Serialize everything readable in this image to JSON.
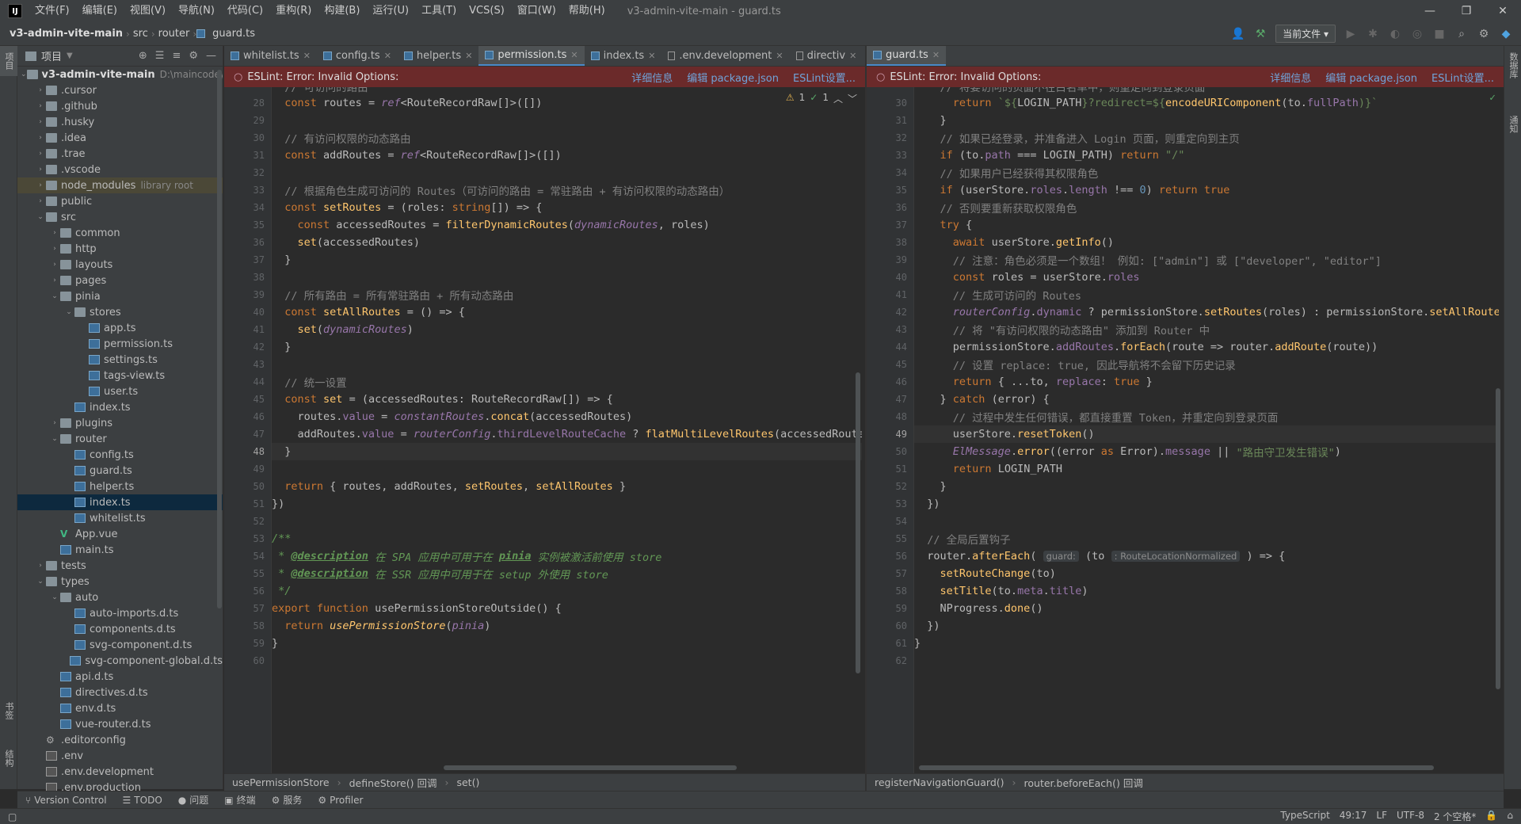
{
  "window": {
    "title": "v3-admin-vite-main - guard.ts",
    "logo": "IJ",
    "menu": [
      "文件(F)",
      "编辑(E)",
      "视图(V)",
      "导航(N)",
      "代码(C)",
      "重构(R)",
      "构建(B)",
      "运行(U)",
      "工具(T)",
      "VCS(S)",
      "窗口(W)",
      "帮助(H)"
    ],
    "controls": [
      "—",
      "❐",
      "✕"
    ]
  },
  "breadcrumb": {
    "project": "v3-admin-vite-main",
    "path": [
      "src",
      "router",
      "guard.ts"
    ]
  },
  "toolbar": {
    "run_config": "当前文件",
    "run_config_arrow": "▾"
  },
  "left_strip": {
    "top_label": "项目",
    "bottom_label_1": "书签",
    "bottom_label_2": "结构"
  },
  "right_strip": {
    "label_1": "数据库",
    "label_2": "通知"
  },
  "project_panel": {
    "title": "项目",
    "root": "v3-admin-vite-main",
    "root_path": "D:\\maincode\\",
    "tree": [
      {
        "depth": 1,
        "arrow": "›",
        "type": "folder",
        "name": ".cursor"
      },
      {
        "depth": 1,
        "arrow": "›",
        "type": "folder",
        "name": ".github"
      },
      {
        "depth": 1,
        "arrow": "›",
        "type": "folder",
        "name": ".husky"
      },
      {
        "depth": 1,
        "arrow": "›",
        "type": "folder",
        "name": ".idea"
      },
      {
        "depth": 1,
        "arrow": "›",
        "type": "folder",
        "name": ".trae"
      },
      {
        "depth": 1,
        "arrow": "›",
        "type": "folder",
        "name": ".vscode"
      },
      {
        "depth": 1,
        "arrow": "›",
        "type": "folder",
        "name": "node_modules",
        "note": "library root",
        "hl": true
      },
      {
        "depth": 1,
        "arrow": "›",
        "type": "folder",
        "name": "public"
      },
      {
        "depth": 1,
        "arrow": "⌄",
        "type": "folder",
        "name": "src"
      },
      {
        "depth": 2,
        "arrow": "›",
        "type": "folder",
        "name": "common"
      },
      {
        "depth": 2,
        "arrow": "›",
        "type": "folder",
        "name": "http"
      },
      {
        "depth": 2,
        "arrow": "›",
        "type": "folder",
        "name": "layouts"
      },
      {
        "depth": 2,
        "arrow": "›",
        "type": "folder",
        "name": "pages"
      },
      {
        "depth": 2,
        "arrow": "⌄",
        "type": "folder",
        "name": "pinia"
      },
      {
        "depth": 3,
        "arrow": "⌄",
        "type": "folder",
        "name": "stores"
      },
      {
        "depth": 4,
        "arrow": "",
        "type": "ts",
        "name": "app.ts"
      },
      {
        "depth": 4,
        "arrow": "",
        "type": "ts",
        "name": "permission.ts"
      },
      {
        "depth": 4,
        "arrow": "",
        "type": "ts",
        "name": "settings.ts"
      },
      {
        "depth": 4,
        "arrow": "",
        "type": "ts",
        "name": "tags-view.ts"
      },
      {
        "depth": 4,
        "arrow": "",
        "type": "ts",
        "name": "user.ts"
      },
      {
        "depth": 3,
        "arrow": "",
        "type": "ts",
        "name": "index.ts"
      },
      {
        "depth": 2,
        "arrow": "›",
        "type": "folder",
        "name": "plugins"
      },
      {
        "depth": 2,
        "arrow": "⌄",
        "type": "folder",
        "name": "router"
      },
      {
        "depth": 3,
        "arrow": "",
        "type": "ts",
        "name": "config.ts"
      },
      {
        "depth": 3,
        "arrow": "",
        "type": "ts",
        "name": "guard.ts"
      },
      {
        "depth": 3,
        "arrow": "",
        "type": "ts",
        "name": "helper.ts"
      },
      {
        "depth": 3,
        "arrow": "",
        "type": "ts",
        "name": "index.ts",
        "sel": true
      },
      {
        "depth": 3,
        "arrow": "",
        "type": "ts",
        "name": "whitelist.ts"
      },
      {
        "depth": 2,
        "arrow": "",
        "type": "vue",
        "name": "App.vue"
      },
      {
        "depth": 2,
        "arrow": "",
        "type": "ts",
        "name": "main.ts"
      },
      {
        "depth": 1,
        "arrow": "›",
        "type": "folder",
        "name": "tests"
      },
      {
        "depth": 1,
        "arrow": "⌄",
        "type": "folder",
        "name": "types"
      },
      {
        "depth": 2,
        "arrow": "⌄",
        "type": "folder",
        "name": "auto"
      },
      {
        "depth": 3,
        "arrow": "",
        "type": "ts",
        "name": "auto-imports.d.ts"
      },
      {
        "depth": 3,
        "arrow": "",
        "type": "ts",
        "name": "components.d.ts"
      },
      {
        "depth": 3,
        "arrow": "",
        "type": "ts",
        "name": "svg-component.d.ts"
      },
      {
        "depth": 3,
        "arrow": "",
        "type": "ts",
        "name": "svg-component-global.d.ts"
      },
      {
        "depth": 2,
        "arrow": "",
        "type": "ts",
        "name": "api.d.ts"
      },
      {
        "depth": 2,
        "arrow": "",
        "type": "ts",
        "name": "directives.d.ts"
      },
      {
        "depth": 2,
        "arrow": "",
        "type": "ts",
        "name": "env.d.ts"
      },
      {
        "depth": 2,
        "arrow": "",
        "type": "ts",
        "name": "vue-router.d.ts"
      },
      {
        "depth": 1,
        "arrow": "",
        "type": "gear",
        "name": ".editorconfig"
      },
      {
        "depth": 1,
        "arrow": "",
        "type": "plain",
        "name": ".env"
      },
      {
        "depth": 1,
        "arrow": "",
        "type": "plain",
        "name": ".env.development"
      },
      {
        "depth": 1,
        "arrow": "",
        "type": "plain",
        "name": ".env.production"
      }
    ]
  },
  "left_editor": {
    "tabs": [
      {
        "name": "whitelist.ts",
        "icon": "ts"
      },
      {
        "name": "config.ts",
        "icon": "ts"
      },
      {
        "name": "helper.ts",
        "icon": "ts"
      },
      {
        "name": "permission.ts",
        "icon": "ts",
        "active": true
      },
      {
        "name": "index.ts",
        "icon": "ts"
      },
      {
        "name": ".env.development",
        "icon": "file"
      },
      {
        "name": "directiv",
        "icon": "folder"
      }
    ],
    "banner": {
      "text": "ESLint: Error: Invalid Options:",
      "links": [
        "详细信息",
        "编辑 package.json",
        "ESLint设置..."
      ]
    },
    "inspection": {
      "warnings": "1",
      "ok": "1"
    },
    "first_line": 28,
    "top_partial": "  // 可访问的路由",
    "lines": [
      [
        [
          "  "
        ],
        [
          "const ",
          "k"
        ],
        [
          "routes = "
        ],
        [
          "ref",
          "i"
        ],
        [
          "<RouteRecordRaw[]>([])"
        ]
      ],
      [
        [
          ""
        ]
      ],
      [
        [
          "  // 有访问权限的动态路由",
          "c"
        ]
      ],
      [
        [
          "  "
        ],
        [
          "const ",
          "k"
        ],
        [
          "addRoutes = "
        ],
        [
          "ref",
          "i"
        ],
        [
          "<RouteRecordRaw[]>([])"
        ]
      ],
      [
        [
          ""
        ]
      ],
      [
        [
          "  // 根据角色生成可访问的 Routes（可访问的路由 = 常驻路由 + 有访问权限的动态路由）",
          "c"
        ]
      ],
      [
        [
          "  "
        ],
        [
          "const ",
          "k"
        ],
        [
          "setRoutes",
          "f"
        ],
        [
          " = (roles: "
        ],
        [
          "string",
          "k"
        ],
        [
          "[]) => {"
        ]
      ],
      [
        [
          "    "
        ],
        [
          "const ",
          "k"
        ],
        [
          "accessedRoutes = "
        ],
        [
          "filterDynamicRoutes",
          "f"
        ],
        [
          "("
        ],
        [
          "dynamicRoutes",
          "i"
        ],
        [
          ", roles)"
        ]
      ],
      [
        [
          "    "
        ],
        [
          "set",
          "f"
        ],
        [
          "(accessedRoutes)"
        ]
      ],
      [
        [
          "  }"
        ]
      ],
      [
        [
          ""
        ]
      ],
      [
        [
          "  // 所有路由 = 所有常驻路由 + 所有动态路由",
          "c"
        ]
      ],
      [
        [
          "  "
        ],
        [
          "const ",
          "k"
        ],
        [
          "setAllRoutes",
          "f"
        ],
        [
          " = () => {"
        ]
      ],
      [
        [
          "    "
        ],
        [
          "set",
          "f"
        ],
        [
          "("
        ],
        [
          "dynamicRoutes",
          "i"
        ],
        [
          ")"
        ]
      ],
      [
        [
          "  }"
        ]
      ],
      [
        [
          ""
        ]
      ],
      [
        [
          "  // 统一设置",
          "c"
        ]
      ],
      [
        [
          "  "
        ],
        [
          "const ",
          "k"
        ],
        [
          "set",
          "f"
        ],
        [
          " = (accessedRoutes: RouteRecordRaw[]) => {"
        ]
      ],
      [
        [
          "    routes."
        ],
        [
          "value",
          "p"
        ],
        [
          " = "
        ],
        [
          "constantRoutes",
          "i"
        ],
        [
          "."
        ],
        [
          "concat",
          "f"
        ],
        [
          "(accessedRoutes)"
        ]
      ],
      [
        [
          "    addRoutes."
        ],
        [
          "value",
          "p"
        ],
        [
          " = "
        ],
        [
          "routerConfig",
          "i"
        ],
        [
          "."
        ],
        [
          "thirdLevelRouteCache",
          "p"
        ],
        [
          " ? "
        ],
        [
          "flatMultiLevelRoutes",
          "f"
        ],
        [
          "(accessedRoutes"
        ]
      ],
      [
        [
          "  }"
        ]
      ],
      [
        [
          ""
        ]
      ],
      [
        [
          "  "
        ],
        [
          "return ",
          "k"
        ],
        [
          "{ routes, addRoutes, "
        ],
        [
          "setRoutes",
          "f"
        ],
        [
          ", "
        ],
        [
          "setAllRoutes",
          "f"
        ],
        [
          " }"
        ]
      ],
      [
        [
          "})"
        ]
      ],
      [
        [
          ""
        ]
      ],
      [
        [
          "/**",
          "d"
        ]
      ],
      [
        [
          " * ",
          "d"
        ],
        [
          "@description",
          "dt"
        ],
        [
          " 在 SPA 应用中可用于在 ",
          "d"
        ],
        [
          "pinia",
          "dt"
        ],
        [
          " 实例被激活前使用 store",
          "d"
        ]
      ],
      [
        [
          " * ",
          "d"
        ],
        [
          "@description",
          "dt"
        ],
        [
          " 在 SSR 应用中可用于在 setup 外使用 store",
          "d"
        ]
      ],
      [
        [
          " */",
          "d"
        ]
      ],
      [
        [
          "export ",
          "k"
        ],
        [
          "function ",
          "k"
        ],
        [
          "usePermissionStoreOutside() {"
        ]
      ],
      [
        [
          "  "
        ],
        [
          "return ",
          "k"
        ],
        [
          "usePermissionStore",
          "fi2"
        ],
        [
          "("
        ],
        [
          "pinia",
          "i"
        ],
        [
          ")"
        ]
      ],
      [
        [
          "}"
        ]
      ],
      [
        [
          ""
        ]
      ]
    ],
    "current_line": 48,
    "breadcrumbs": [
      "usePermissionStore",
      "defineStore() 回调",
      "set()"
    ]
  },
  "right_editor": {
    "tabs": [
      {
        "name": "guard.ts",
        "icon": "ts",
        "active": true
      }
    ],
    "banner": {
      "text": "ESLint: Error: Invalid Options:",
      "links": [
        "详细信息",
        "编辑 package.json",
        "ESLint设置..."
      ]
    },
    "first_line": 30,
    "top_partial": "    // 将要访问的页面不在白名单中，则重定向到登录页面",
    "lines": [
      [
        [
          "      "
        ],
        [
          "return ",
          "k"
        ],
        [
          "`${",
          "s"
        ],
        [
          "LOGIN_PATH"
        ],
        [
          "}?redirect=${",
          "s"
        ],
        [
          "encodeURIComponent",
          "f"
        ],
        [
          "(to."
        ],
        [
          "fullPath",
          "p"
        ],
        [
          ")}`",
          "s"
        ]
      ],
      [
        [
          "    }"
        ]
      ],
      [
        [
          "    // 如果已经登录，并准备进入 Login 页面，则重定向到主页",
          "c"
        ]
      ],
      [
        [
          "    "
        ],
        [
          "if ",
          "k"
        ],
        [
          "(to."
        ],
        [
          "path",
          "p"
        ],
        [
          " === LOGIN_PATH) "
        ],
        [
          "return ",
          "k"
        ],
        [
          "\"/\"",
          "s"
        ]
      ],
      [
        [
          "    // 如果用户已经获得其权限角色",
          "c"
        ]
      ],
      [
        [
          "    "
        ],
        [
          "if ",
          "k"
        ],
        [
          "(userStore."
        ],
        [
          "roles",
          "p"
        ],
        [
          "."
        ],
        [
          "length",
          "p"
        ],
        [
          " !== "
        ],
        [
          "0",
          "n"
        ],
        [
          ") "
        ],
        [
          "return ",
          "k"
        ],
        [
          "true",
          "k"
        ]
      ],
      [
        [
          "    // 否则要重新获取权限角色",
          "c"
        ]
      ],
      [
        [
          "    "
        ],
        [
          "try ",
          "k"
        ],
        [
          "{"
        ]
      ],
      [
        [
          "      "
        ],
        [
          "await ",
          "k"
        ],
        [
          "userStore."
        ],
        [
          "getInfo",
          "f"
        ],
        [
          "()"
        ]
      ],
      [
        [
          "      // 注意：角色必须是一个数组！ 例如: [\"admin\"] 或 [\"developer\", \"editor\"]",
          "c"
        ]
      ],
      [
        [
          "      "
        ],
        [
          "const ",
          "k"
        ],
        [
          "roles = userStore."
        ],
        [
          "roles",
          "p"
        ]
      ],
      [
        [
          "      // 生成可访问的 Routes",
          "c"
        ]
      ],
      [
        [
          "      "
        ],
        [
          "routerConfig",
          "i"
        ],
        [
          "."
        ],
        [
          "dynamic",
          "p"
        ],
        [
          " ? permissionStore."
        ],
        [
          "setRoutes",
          "f"
        ],
        [
          "(roles) : permissionStore."
        ],
        [
          "setAllRoutes",
          "f"
        ],
        [
          "("
        ]
      ],
      [
        [
          "      // 将 \"有访问权限的动态路由\" 添加到 Router 中",
          "c"
        ]
      ],
      [
        [
          "      permissionStore."
        ],
        [
          "addRoutes",
          "p"
        ],
        [
          "."
        ],
        [
          "forEach",
          "f"
        ],
        [
          "(route => router."
        ],
        [
          "addRoute",
          "f"
        ],
        [
          "(route))"
        ]
      ],
      [
        [
          "      // 设置 replace: true, 因此导航将不会留下历史记录",
          "c"
        ]
      ],
      [
        [
          "      "
        ],
        [
          "return ",
          "k"
        ],
        [
          "{ ...to, "
        ],
        [
          "replace",
          "p"
        ],
        [
          ": "
        ],
        [
          "true ",
          "k"
        ],
        [
          "}"
        ]
      ],
      [
        [
          "    } "
        ],
        [
          "catch ",
          "k"
        ],
        [
          "(error) {"
        ]
      ],
      [
        [
          "      // 过程中发生任何错误，都直接重置 Token，并重定向到登录页面",
          "c"
        ]
      ],
      [
        [
          "      userStore."
        ],
        [
          "resetToken",
          "f"
        ],
        [
          "()"
        ]
      ],
      [
        [
          "      "
        ],
        [
          "ElMessage",
          "i"
        ],
        [
          "."
        ],
        [
          "error",
          "f"
        ],
        [
          "((error "
        ],
        [
          "as ",
          "k"
        ],
        [
          "Error)."
        ],
        [
          "message",
          "p"
        ],
        [
          " || "
        ],
        [
          "\"路由守卫发生错误\"",
          "s"
        ],
        [
          ")"
        ]
      ],
      [
        [
          "      "
        ],
        [
          "return ",
          "k"
        ],
        [
          "LOGIN_PATH"
        ]
      ],
      [
        [
          "    }"
        ]
      ],
      [
        [
          "  })"
        ]
      ],
      [
        [
          ""
        ]
      ],
      [
        [
          "  // 全局后置钩子",
          "c"
        ]
      ],
      [
        [
          "  router."
        ],
        [
          "afterEach",
          "f"
        ],
        [
          "( "
        ],
        [
          "guard:",
          "hint"
        ],
        [
          " (to "
        ],
        [
          ": RouteLocationNormalized",
          "hint"
        ],
        [
          " ) => {"
        ]
      ],
      [
        [
          "    "
        ],
        [
          "setRouteChange",
          "f"
        ],
        [
          "(to)"
        ]
      ],
      [
        [
          "    "
        ],
        [
          "setTitle",
          "f"
        ],
        [
          "(to."
        ],
        [
          "meta",
          "p"
        ],
        [
          "."
        ],
        [
          "title",
          "p"
        ],
        [
          ")"
        ]
      ],
      [
        [
          "    NProgress."
        ],
        [
          "done",
          "f"
        ],
        [
          "()"
        ]
      ],
      [
        [
          "  })"
        ]
      ],
      [
        [
          "}"
        ]
      ],
      [
        [
          ""
        ]
      ]
    ],
    "current_line": 49,
    "breadcrumbs": [
      "registerNavigationGuard()",
      "router.beforeEach() 回调"
    ]
  },
  "tool_tabs": [
    {
      "icon": "⑂",
      "label": "Version Control"
    },
    {
      "icon": "☰",
      "label": "TODO"
    },
    {
      "icon": "●",
      "label": "问题"
    },
    {
      "icon": "▣",
      "label": "终端"
    },
    {
      "icon": "⚙",
      "label": "服务"
    },
    {
      "icon": "⚙",
      "label": "Profiler"
    }
  ],
  "status": {
    "lang": "TypeScript",
    "pos": "49:17",
    "eol": "LF",
    "enc": "UTF-8",
    "indent": "2 个空格*",
    "lock": "🔒",
    "extra": "⌂"
  }
}
